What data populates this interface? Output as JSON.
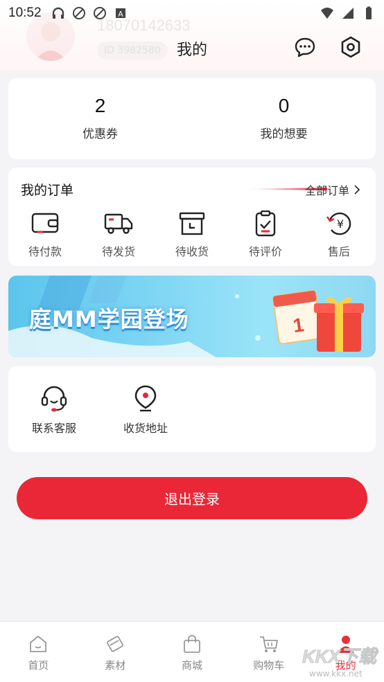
{
  "status_bar": {
    "time": "10:52"
  },
  "profile": {
    "phone": "18070142633",
    "id_text": "ID  3982580"
  },
  "header": {
    "title": "我的"
  },
  "stats": [
    {
      "value": "2",
      "label": "优惠券"
    },
    {
      "value": "0",
      "label": "我的想要"
    }
  ],
  "orders": {
    "title": "我的订单",
    "all_label": "全部订单",
    "items": [
      {
        "label": "待付款",
        "icon": "wallet-icon"
      },
      {
        "label": "待发货",
        "icon": "truck-icon"
      },
      {
        "label": "待收货",
        "icon": "box-icon"
      },
      {
        "label": "待评价",
        "icon": "clipboard-check-icon"
      },
      {
        "label": "售后",
        "icon": "refund-yen-icon"
      }
    ]
  },
  "banner": {
    "text": "庭MM学园登场"
  },
  "services": [
    {
      "label": "联系客服",
      "icon": "headset-icon"
    },
    {
      "label": "收货地址",
      "icon": "location-pin-icon"
    }
  ],
  "logout": {
    "label": "退出登录"
  },
  "tabbar": [
    {
      "label": "首页",
      "icon": "home-icon",
      "active": false
    },
    {
      "label": "素材",
      "icon": "material-icon",
      "active": false
    },
    {
      "label": "商城",
      "icon": "shopping-bag-icon",
      "active": false
    },
    {
      "label": "购物车",
      "icon": "cart-icon",
      "active": false
    },
    {
      "label": "我的",
      "icon": "user-icon",
      "active": true
    }
  ],
  "watermark": {
    "text": "KKX下载",
    "url": "www.kkx.net"
  },
  "colors": {
    "accent": "#ea2737",
    "background": "#f4f4f6"
  }
}
